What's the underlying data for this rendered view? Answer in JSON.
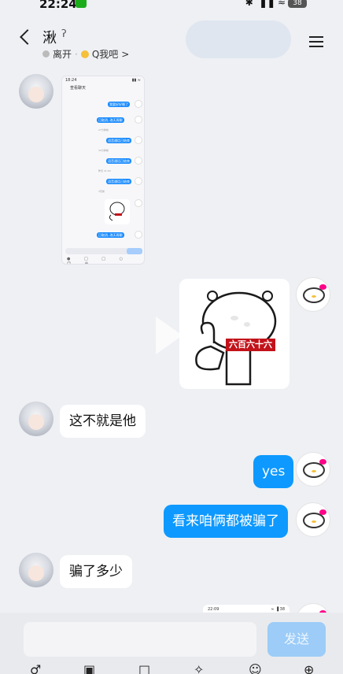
{
  "statusbar": {
    "time": "22:24",
    "sys_icons": "✱ ▐▐ ≈",
    "battery": "38"
  },
  "header": {
    "title": "湫",
    "ear_icon": "ʔ",
    "status": "离开",
    "location": "Q我吧",
    "chevron": ">"
  },
  "messages": {
    "m3": "这不就是他",
    "m4": "yes",
    "m5": "看来咱俩都被骗了",
    "m6": "骗了多少"
  },
  "screenshot": {
    "time": "18:24",
    "title": "查看聊天",
    "bubbles": [
      "我要好好睡了",
      "已取消, 改天再聊",
      "语音通话已结束",
      "语音通话已结束",
      "语音通话已结束",
      "已取消, 改天再聊"
    ],
    "timestamps": [
      "27分钟前",
      "32分钟前",
      "昨天 21:04",
      "3天前"
    ],
    "toolbar": "● □ □ ○ ☺ ⊕"
  },
  "sticker": {
    "label": "六百六十六"
  },
  "pending": {
    "time": "22:09",
    "status": "≈ ▐ 38"
  },
  "input": {
    "send_label": "发送"
  },
  "toolbar": {
    "icons": [
      "♂",
      "▣",
      "□",
      "✧",
      "☺",
      "⊕"
    ]
  },
  "colors": {
    "accent": "#0d99ff",
    "send_disabled": "#9cccf7",
    "background": "#eef0f4"
  }
}
